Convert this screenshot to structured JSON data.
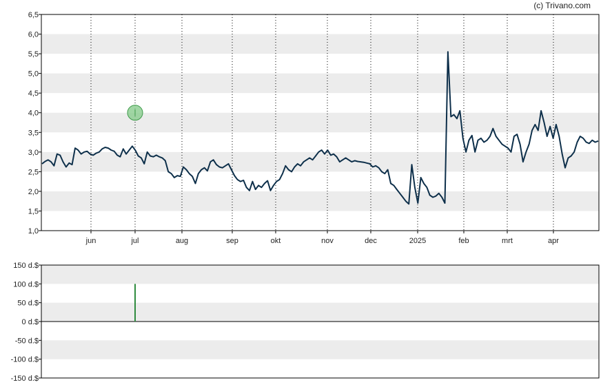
{
  "credit": "(c) Trivano.com",
  "colors": {
    "price_line": "#0d2f4a",
    "band": "#ececec",
    "axis": "#000000",
    "gridline": "#000000",
    "dividend_bar": "#2e8b3e",
    "marker_fill": "#8fcf94",
    "marker_stroke": "#3e9a4a"
  },
  "chart_data": [
    {
      "type": "line",
      "grid": "vertical dotted gridlines, alternating horizontal bands",
      "ylim": [
        1.0,
        6.5
      ],
      "y_ticks": [
        "6,5",
        "6,0",
        "5,5",
        "5,0",
        "4,5",
        "4,0",
        "3,5",
        "3,0",
        "2,5",
        "2,0",
        "1,5",
        "1,0"
      ],
      "x_ticks": [
        "jun",
        "jul",
        "aug",
        "sep",
        "okt",
        "nov",
        "dec",
        "2025",
        "feb",
        "mrt",
        "apr"
      ],
      "series": [
        {
          "values": [
            2.7,
            2.76,
            2.8,
            2.75,
            2.65,
            2.95,
            2.92,
            2.75,
            2.62,
            2.72,
            2.68,
            3.1,
            3.05,
            2.95,
            3.0,
            3.02,
            2.95,
            2.92,
            2.97,
            3.0,
            3.08,
            3.12,
            3.1,
            3.05,
            3.02,
            2.92,
            2.88,
            3.08,
            2.95,
            3.05,
            3.15,
            3.05,
            2.9,
            2.85,
            2.7,
            3.0,
            2.9,
            2.88,
            2.92,
            2.88,
            2.85,
            2.78,
            2.5,
            2.45,
            2.35,
            2.4,
            2.38,
            2.62,
            2.55,
            2.45,
            2.38,
            2.2,
            2.45,
            2.55,
            2.6,
            2.52,
            2.75,
            2.8,
            2.68,
            2.62,
            2.6,
            2.65,
            2.7,
            2.55,
            2.4,
            2.3,
            2.25,
            2.28,
            2.1,
            2.02,
            2.25,
            2.05,
            2.15,
            2.1,
            2.2,
            2.27,
            2.02,
            2.15,
            2.25,
            2.3,
            2.45,
            2.65,
            2.55,
            2.5,
            2.62,
            2.7,
            2.65,
            2.75,
            2.8,
            2.85,
            2.8,
            2.9,
            3.0,
            3.05,
            2.95,
            3.05,
            2.92,
            2.95,
            2.88,
            2.75,
            2.8,
            2.85,
            2.8,
            2.75,
            2.78,
            2.76,
            2.75,
            2.74,
            2.72,
            2.7,
            2.62,
            2.65,
            2.6,
            2.5,
            2.45,
            2.55,
            2.2,
            2.15,
            2.05,
            1.95,
            1.85,
            1.75,
            1.68,
            2.68,
            2.1,
            1.7,
            2.35,
            2.2,
            2.1,
            1.9,
            1.85,
            1.88,
            1.95,
            1.85,
            1.7,
            5.55,
            3.9,
            3.95,
            3.85,
            4.05,
            3.35,
            3.0,
            3.3,
            3.42,
            3.0,
            3.3,
            3.35,
            3.25,
            3.3,
            3.4,
            3.6,
            3.4,
            3.3,
            3.2,
            3.15,
            3.1,
            3.0,
            3.4,
            3.45,
            3.2,
            2.75,
            3.0,
            3.2,
            3.55,
            3.7,
            3.55,
            4.05,
            3.75,
            3.4,
            3.65,
            3.35,
            3.7,
            3.4,
            2.95,
            2.6,
            2.85,
            2.9,
            3.0,
            3.25,
            3.4,
            3.35,
            3.25,
            3.22,
            3.3,
            3.25,
            3.28
          ]
        }
      ],
      "marker": {
        "x_index": 30,
        "value": 4.0
      }
    },
    {
      "type": "bar",
      "grid": "alternating horizontal bands",
      "ylim": [
        -150,
        150
      ],
      "y_ticks": [
        "150 d.$",
        "100 d.$",
        "50 d.$",
        "0 d.$",
        "-50 d.$",
        "-100 d.$",
        "-150 d.$"
      ],
      "bars": [
        {
          "x_index": 30,
          "value": 100
        }
      ]
    }
  ]
}
